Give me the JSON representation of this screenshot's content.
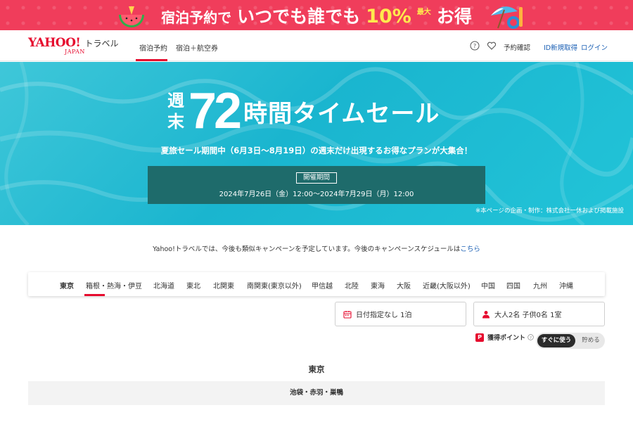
{
  "promo": {
    "text1": "宿泊予約で",
    "text2": "いつでも誰でも",
    "percent": "10%",
    "max_label": "最大",
    "text3": "お得",
    "bg_color": "#f03d5b"
  },
  "header": {
    "logo_yahoo": "YAHOO!",
    "logo_japan": "JAPAN",
    "logo_travel": "トラベル",
    "tabs": [
      {
        "label": "宿泊予約",
        "active": true
      },
      {
        "label": "宿泊＋航空券",
        "active": false
      }
    ],
    "icons": [
      "help-icon",
      "heart-icon"
    ],
    "links": {
      "reservation": "予約確認",
      "signup": "ID新規取得",
      "login": "ログイン"
    },
    "accent_color": "#e60b2e"
  },
  "hero": {
    "week_top": "週",
    "week_bottom": "末",
    "hours": "72",
    "title_rest": "時間タイムセール",
    "subtitle": "夏旅セール期間中（6月3日〜8月19日）の週末だけ出現するお得なプランが大集合！",
    "period_label": "開催期間",
    "period_dates": "2024年7月26日（金）12:00〜2024年7月29日（月）12:00",
    "note": "※本ページの企画・制作：株式会社一休および掲載施設"
  },
  "notice": {
    "text": "Yahoo!トラベルでは、今後も類似キャンペーンを予定しています。今後のキャンペーンスケジュールは",
    "link": "こちら"
  },
  "regions": [
    {
      "label": "東京",
      "active": true
    },
    {
      "label": "箱根・熱海・伊豆",
      "active": false
    },
    {
      "label": "北海道",
      "active": false
    },
    {
      "label": "東北",
      "active": false
    },
    {
      "label": "北関東",
      "active": false
    },
    {
      "label": "南関東(東京以外)",
      "active": false
    },
    {
      "label": "甲信越",
      "active": false
    },
    {
      "label": "北陸",
      "active": false
    },
    {
      "label": "東海",
      "active": false
    },
    {
      "label": "大阪",
      "active": false
    },
    {
      "label": "近畿(大阪以外)",
      "active": false
    },
    {
      "label": "中国",
      "active": false
    },
    {
      "label": "四国",
      "active": false
    },
    {
      "label": "九州",
      "active": false
    },
    {
      "label": "沖縄",
      "active": false
    }
  ],
  "search": {
    "date_value": "日付指定なし 1泊",
    "guests_value": "大人2名 子供0名 1室"
  },
  "points": {
    "icon_label": "P",
    "label": "獲得ポイント",
    "toggle_on": "すぐに使う",
    "toggle_off": "貯める"
  },
  "area": {
    "heading": "東京",
    "first_row": "池袋・赤羽・巣鴨"
  }
}
